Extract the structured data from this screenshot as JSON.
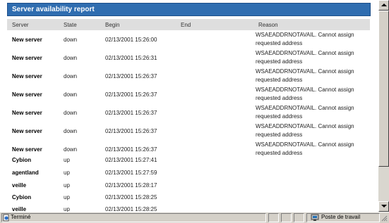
{
  "report": {
    "title": "Server availability report",
    "columns": [
      "Server",
      "State",
      "Begin",
      "End",
      "Reason"
    ],
    "rows": [
      {
        "server": "New server",
        "state": "down",
        "begin": "02/13/2001 15:26:00",
        "end": "",
        "reason_line1": "WSAEADDRNOTAVAIL. Cannot assign",
        "reason_line2": "requested address"
      },
      {
        "server": "New server",
        "state": "down",
        "begin": "02/13/2001 15:26:31",
        "end": "",
        "reason_line1": "WSAEADDRNOTAVAIL. Cannot assign",
        "reason_line2": "requested address"
      },
      {
        "server": "New server",
        "state": "down",
        "begin": "02/13/2001 15:26:37",
        "end": "",
        "reason_line1": "WSAEADDRNOTAVAIL. Cannot assign",
        "reason_line2": "requested address"
      },
      {
        "server": "New server",
        "state": "down",
        "begin": "02/13/2001 15:26:37",
        "end": "",
        "reason_line1": "WSAEADDRNOTAVAIL. Cannot assign",
        "reason_line2": "requested address"
      },
      {
        "server": "New server",
        "state": "down",
        "begin": "02/13/2001 15:26:37",
        "end": "",
        "reason_line1": "WSAEADDRNOTAVAIL. Cannot assign",
        "reason_line2": "requested address"
      },
      {
        "server": "New server",
        "state": "down",
        "begin": "02/13/2001 15:26:37",
        "end": "",
        "reason_line1": "WSAEADDRNOTAVAIL. Cannot assign",
        "reason_line2": "requested address"
      },
      {
        "server": "New server",
        "state": "down",
        "begin": "02/13/2001 15:26:37",
        "end": "",
        "reason_line1": "WSAEADDRNOTAVAIL. Cannot assign",
        "reason_line2": "requested address"
      },
      {
        "server": "Cybion",
        "state": "up",
        "begin": "02/13/2001 15:27:41",
        "end": "",
        "reason_line1": "",
        "reason_line2": ""
      },
      {
        "server": "agentland",
        "state": "up",
        "begin": "02/13/2001 15:27:59",
        "end": "",
        "reason_line1": "",
        "reason_line2": ""
      },
      {
        "server": "veille",
        "state": "up",
        "begin": "02/13/2001 15:28:17",
        "end": "",
        "reason_line1": "",
        "reason_line2": ""
      },
      {
        "server": "Cybion",
        "state": "up",
        "begin": "02/13/2001 15:28:25",
        "end": "",
        "reason_line1": "",
        "reason_line2": ""
      },
      {
        "server": "veille",
        "state": "up",
        "begin": "02/13/2001 15:28:25",
        "end": "",
        "reason_line1": "",
        "reason_line2": ""
      }
    ]
  },
  "statusbar": {
    "status": "Terminé",
    "zone": "Poste de travail"
  },
  "colors": {
    "title_bar": "#2f6db0",
    "header_bg": "#dedede",
    "chrome": "#d4d0c8"
  },
  "icons": [
    "page-done-icon",
    "computer-icon",
    "scroll-up-arrow-icon",
    "scroll-down-arrow-icon"
  ]
}
